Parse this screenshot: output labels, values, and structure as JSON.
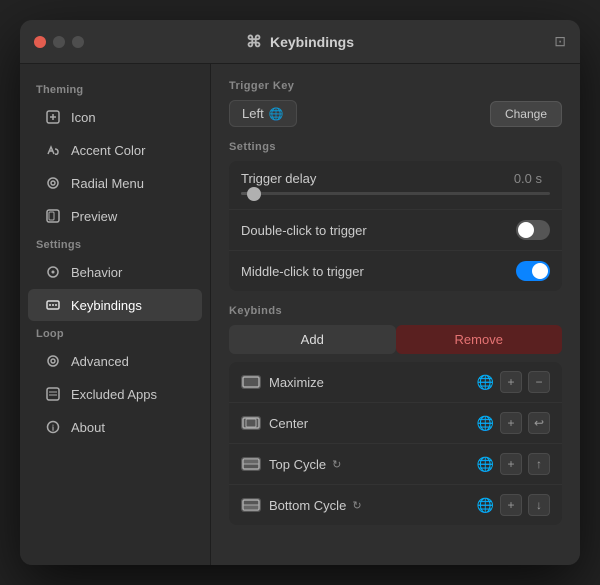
{
  "window": {
    "title": "Keybindings",
    "title_icon": "⌘"
  },
  "sidebar": {
    "sections": [
      {
        "label": "Theming",
        "items": [
          {
            "id": "icon",
            "label": "Icon",
            "icon": "➕"
          },
          {
            "id": "accent-color",
            "label": "Accent Color",
            "icon": "✏️"
          },
          {
            "id": "radial-menu",
            "label": "Radial Menu",
            "icon": "◎"
          },
          {
            "id": "preview",
            "label": "Preview",
            "icon": "⊡"
          }
        ]
      },
      {
        "label": "Settings",
        "items": [
          {
            "id": "behavior",
            "label": "Behavior",
            "icon": "⚙"
          },
          {
            "id": "keybindings",
            "label": "Keybindings",
            "icon": "⌘",
            "active": true
          }
        ]
      },
      {
        "label": "Loop",
        "items": [
          {
            "id": "advanced",
            "label": "Advanced",
            "icon": "◎"
          },
          {
            "id": "excluded-apps",
            "label": "Excluded Apps",
            "icon": "⊡"
          },
          {
            "id": "about",
            "label": "About",
            "icon": "ℹ"
          }
        ]
      }
    ]
  },
  "content": {
    "trigger_key_section": "Trigger Key",
    "trigger_key_label": "Left",
    "trigger_key_globe": "🌐",
    "change_button": "Change",
    "settings_section": "Settings",
    "trigger_delay_label": "Trigger delay",
    "trigger_delay_value": "0.0 s",
    "double_click_label": "Double-click to trigger",
    "middle_click_label": "Middle-click to trigger",
    "keybinds_section": "Keybinds",
    "add_button": "Add",
    "remove_button": "Remove",
    "keybinds": [
      {
        "id": "maximize",
        "name": "Maximize",
        "icon_type": "maximize"
      },
      {
        "id": "center",
        "name": "Center",
        "icon_type": "center"
      },
      {
        "id": "top-cycle",
        "name": "Top Cycle",
        "icon_type": "top-half",
        "has_cycle": true
      },
      {
        "id": "bottom-cycle",
        "name": "Bottom Cycle",
        "icon_type": "bottom-half",
        "has_cycle": true
      }
    ]
  }
}
